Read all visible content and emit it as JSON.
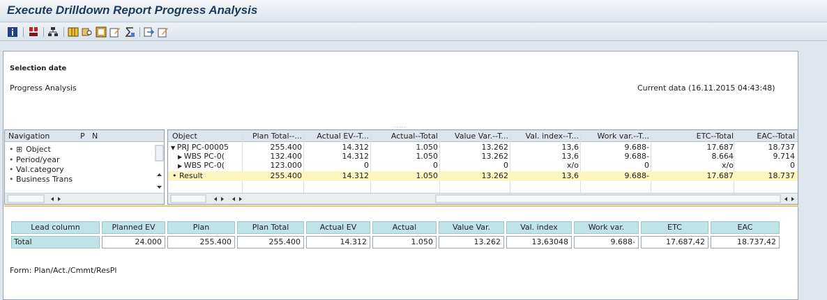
{
  "window": {
    "title": "Execute Drilldown Report Progress Analysis"
  },
  "toolbar": {
    "icons": [
      "info-icon",
      "multi-select-icon",
      "hierarchy-icon",
      "columns-icon",
      "print-preview-icon",
      "graphic-icon",
      "edit-icon",
      "sum-icon",
      "export-icon",
      "change-icon"
    ]
  },
  "header": {
    "selection_date": "Selection date",
    "title": "Progress Analysis",
    "current_data": "Current data (16.11.2015 04:43:48)"
  },
  "navigation": {
    "columns": [
      "Navigation",
      "P",
      "N"
    ],
    "items": [
      "Object",
      "Period/year",
      "Val.category",
      "Business Trans"
    ]
  },
  "grid": {
    "columns": [
      "Object",
      "Plan Total--...",
      "Actual EV--T...",
      "Actual--Total",
      "Value Var.--T...",
      "Val. index--T...",
      "Work var.--T...",
      "ETC--Total",
      "EAC--Total"
    ],
    "rows": [
      {
        "object": "PRJ PC-00005",
        "cells": [
          "255.400",
          "14.312",
          "1.050",
          "13.262",
          "13,6",
          "9.688-",
          "17.687",
          "18.737"
        ]
      },
      {
        "object": "WBS PC-0(",
        "cells": [
          "132.400",
          "14.312",
          "1.050",
          "13.262",
          "13,6",
          "9.688-",
          "8.664",
          "9.714"
        ]
      },
      {
        "object": "WBS PC-0(",
        "cells": [
          "123.000",
          "0",
          "0",
          "0",
          "x/o",
          "0",
          "x/o",
          "0"
        ]
      },
      {
        "object": "Result",
        "cells": [
          "255.400",
          "14.312",
          "1.050",
          "13.262",
          "13,6",
          "9.688-",
          "17.687",
          "18.737"
        ]
      }
    ]
  },
  "lower_table": {
    "headers": [
      "Lead column",
      "Planned EV",
      "Plan",
      "Plan Total",
      "Actual EV",
      "Actual",
      "Value Var.",
      "Val. index",
      "Work var.",
      "ETC",
      "EAC"
    ],
    "row": [
      "Total",
      "24.000",
      "255.400",
      "255.400",
      "14.312",
      "1.050",
      "13.262",
      "13,63048",
      "9.688-",
      "17.687,42",
      "18.737,42"
    ]
  },
  "footer": {
    "form": "Form: Plan/Act./Cmmt/ResPl"
  }
}
